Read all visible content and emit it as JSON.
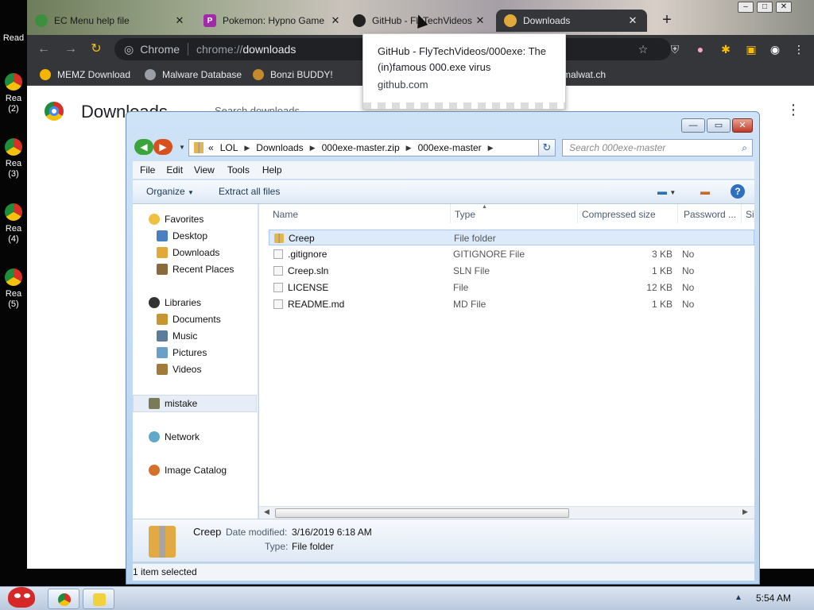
{
  "desktop": {
    "icons": [
      {
        "label": "Read"
      },
      {
        "label": "Rea (2)"
      },
      {
        "label": "Rea (3)"
      },
      {
        "label": "Rea (4)"
      },
      {
        "label": "Rea (5)"
      }
    ]
  },
  "chrome": {
    "tabs": [
      {
        "title": "EC Menu help file",
        "favicon": "chrome-icon"
      },
      {
        "title": "Pokemon: Hypno Game",
        "favicon": "p-icon"
      },
      {
        "title": "GitHub - FlyTechVideos",
        "favicon": "github-icon"
      },
      {
        "title": "Downloads",
        "favicon": "download-icon"
      }
    ],
    "new_tab_label": "+",
    "omnibox_site": "Chrome",
    "omnibox_scheme": "chrome://",
    "omnibox_path": "downloads",
    "bookmarks": [
      {
        "label": "MEMZ Download"
      },
      {
        "label": "Malware Database"
      },
      {
        "label": "Bonzi BUDDY!"
      },
      {
        "label": "malwat.ch"
      }
    ],
    "downloads_title": "Downloads",
    "search_placeholder": "Search downloads",
    "hover_card": {
      "title": "GitHub - FlyTechVideos/000exe: The (in)famous 000.exe virus",
      "domain": "github.com"
    }
  },
  "explorer": {
    "breadcrumb": [
      "LOL",
      "Downloads",
      "000exe-master.zip",
      "000exe-master"
    ],
    "overflow": "«",
    "search_placeholder": "Search 000exe-master",
    "menu": [
      "File",
      "Edit",
      "View",
      "Tools",
      "Help"
    ],
    "commands": {
      "organize": "Organize",
      "extract": "Extract all files"
    },
    "nav": {
      "favorites": "Favorites",
      "favorites_items": [
        "Desktop",
        "Downloads",
        "Recent Places"
      ],
      "libraries": "Libraries",
      "libraries_items": [
        "Documents",
        "Music",
        "Pictures",
        "Videos"
      ],
      "mistake": "mistake",
      "network": "Network",
      "image_catalog": "Image Catalog"
    },
    "columns": [
      "Name",
      "Type",
      "Compressed size",
      "Password ...",
      "Si"
    ],
    "files": [
      {
        "name": "Creep",
        "type": "File folder",
        "size": "",
        "password": ""
      },
      {
        "name": ".gitignore",
        "type": "GITIGNORE File",
        "size": "3 KB",
        "password": "No"
      },
      {
        "name": "Creep.sln",
        "type": "SLN File",
        "size": "1 KB",
        "password": "No"
      },
      {
        "name": "LICENSE",
        "type": "File",
        "size": "12 KB",
        "password": "No"
      },
      {
        "name": "README.md",
        "type": "MD File",
        "size": "1 KB",
        "password": "No"
      }
    ],
    "details": {
      "name": "Creep",
      "date_label": "Date modified:",
      "date_value": "3/16/2019 6:18 AM",
      "type_label": "Type:",
      "type_value": "File folder"
    },
    "status": "1 item selected"
  },
  "taskbar": {
    "clock": "5:54 AM"
  }
}
